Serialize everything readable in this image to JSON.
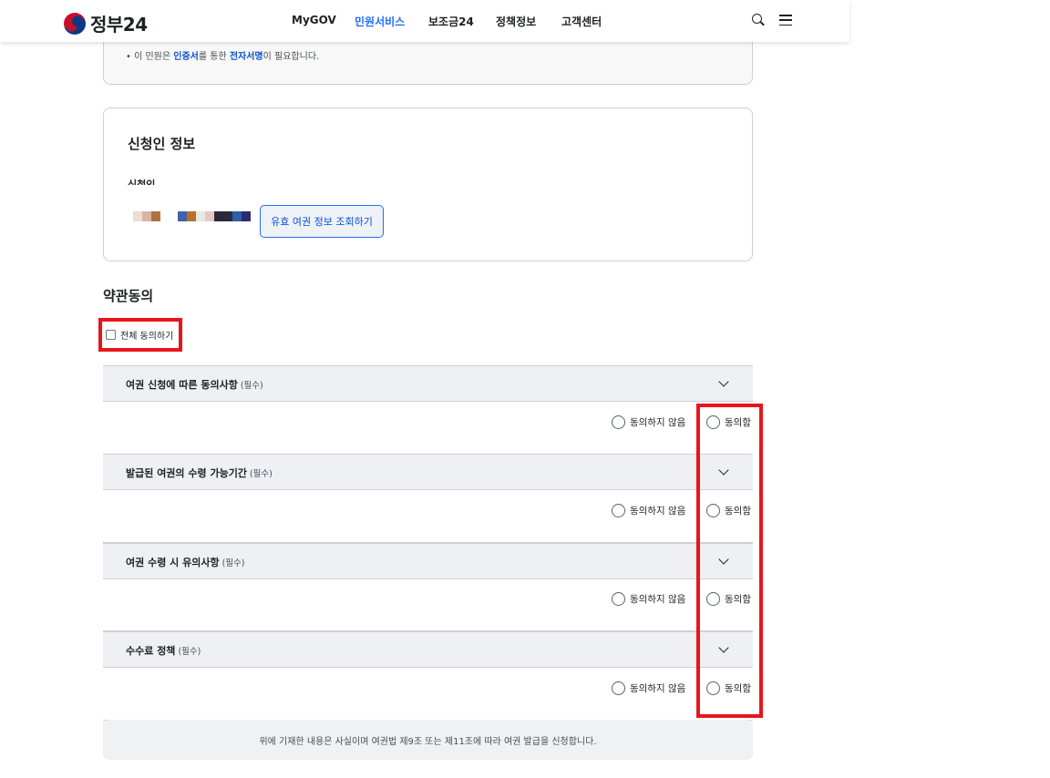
{
  "header": {
    "logo_text": "정부24",
    "nav": [
      "MyGOV",
      "민원서비스",
      "보조금24",
      "정책정보",
      "고객센터"
    ],
    "active_nav": "민원서비스"
  },
  "notice": {
    "prefix": "• 이 민원은 ",
    "strong1": "인증서",
    "mid": "를 통한 ",
    "strong2": "전자서명",
    "suffix": "이 필요합니다."
  },
  "applicant": {
    "title": "신청인 정보",
    "label": "신청인",
    "passport_button": "유효 여권 정보 조회하기"
  },
  "terms": {
    "title": "약관동의",
    "agree_all": "전체 동의하기",
    "items": [
      {
        "title": "여권 신청에 따른 동의사항",
        "required": "(필수)",
        "disagree": "동의하지 않음",
        "agree": "동의함"
      },
      {
        "title": "발급된 여권의 수령 가능기간",
        "required": "(필수)",
        "disagree": "동의하지 않음",
        "agree": "동의함"
      },
      {
        "title": "여권 수령 시 유의사항",
        "required": "(필수)",
        "disagree": "동의하지 않음",
        "agree": "동의함"
      },
      {
        "title": "수수료 정책",
        "required": "(필수)",
        "disagree": "동의하지 않음",
        "agree": "동의함"
      }
    ]
  },
  "declaration": "위에 기재한 내용은 사실이며 여권법 제9조 또는 제11조에 따라 여권 발급을 신청합니다.",
  "colors": {
    "accent": "#256ef4",
    "highlight": "#e8151b"
  }
}
